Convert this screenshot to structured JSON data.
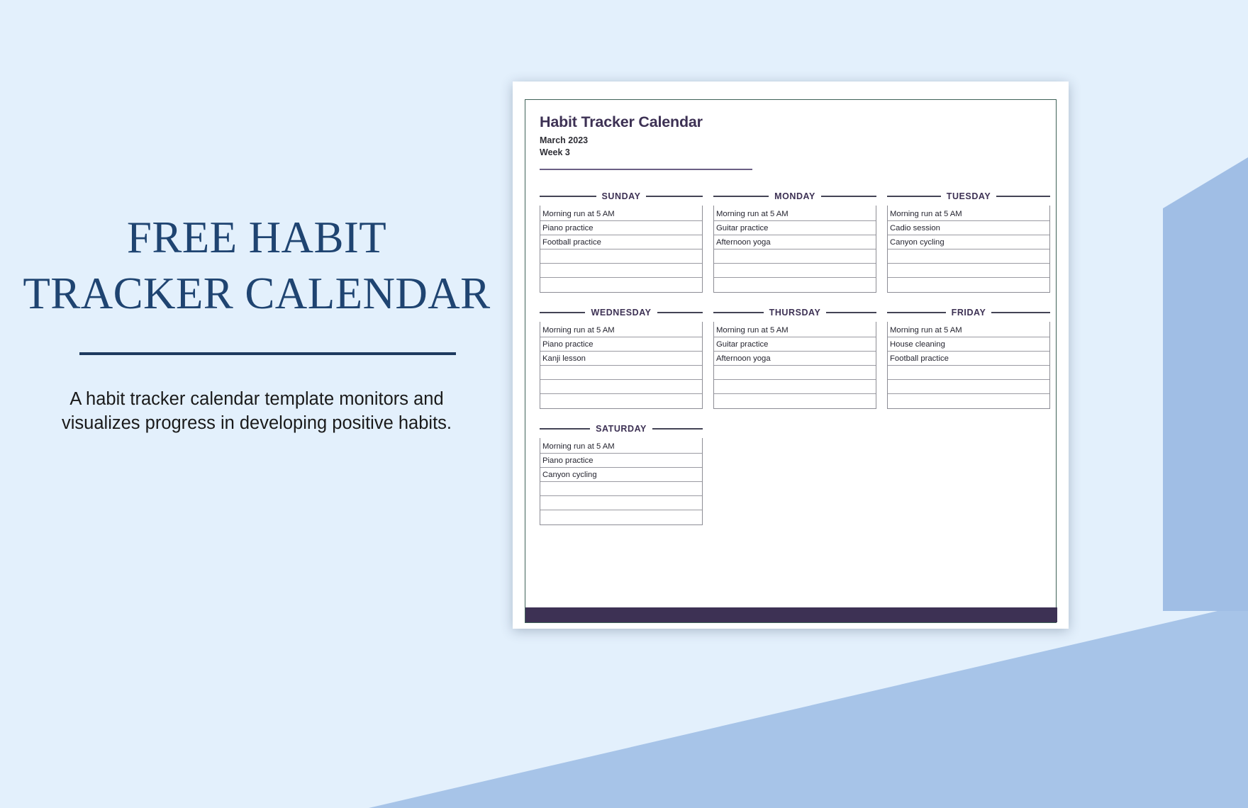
{
  "promo": {
    "title": "FREE HABIT TRACKER CALENDAR",
    "title_line1": "FREE HABIT",
    "title_line2": "TRACKER CALENDAR",
    "description": "A habit tracker calendar template monitors and visualizes progress in developing positive habits."
  },
  "colors": {
    "background": "#e3f0fc",
    "wedge": "#a7c4e8",
    "promo_title": "#1f4471",
    "promo_divider": "#1e3a5f",
    "doc_accent": "#3d3154",
    "doc_border": "#3e6157",
    "row_border": "#8d8d95"
  },
  "document": {
    "title": "Habit Tracker Calendar",
    "month": "March 2023",
    "week": "Week 3",
    "days": [
      {
        "name": "SUNDAY",
        "habits": [
          "Morning run at 5 AM",
          "Piano practice",
          "Football practice",
          "",
          "",
          ""
        ]
      },
      {
        "name": "MONDAY",
        "habits": [
          "Morning run at 5 AM",
          "Guitar practice",
          "Afternoon yoga",
          "",
          "",
          ""
        ]
      },
      {
        "name": "TUESDAY",
        "habits": [
          "Morning run at 5 AM",
          "Cadio session",
          "Canyon cycling",
          "",
          "",
          ""
        ]
      },
      {
        "name": "WEDNESDAY",
        "habits": [
          "Morning run at 5 AM",
          "Piano practice",
          "Kanji lesson",
          "",
          "",
          ""
        ]
      },
      {
        "name": "THURSDAY",
        "habits": [
          "Morning run at 5 AM",
          "Guitar practice",
          "Afternoon yoga",
          "",
          "",
          ""
        ]
      },
      {
        "name": "FRIDAY",
        "habits": [
          "Morning run at 5 AM",
          "House cleaning",
          "Football practice",
          "",
          "",
          ""
        ]
      },
      {
        "name": "SATURDAY",
        "habits": [
          "Morning run at 5 AM",
          "Piano practice",
          "Canyon cycling",
          "",
          "",
          ""
        ]
      }
    ]
  }
}
